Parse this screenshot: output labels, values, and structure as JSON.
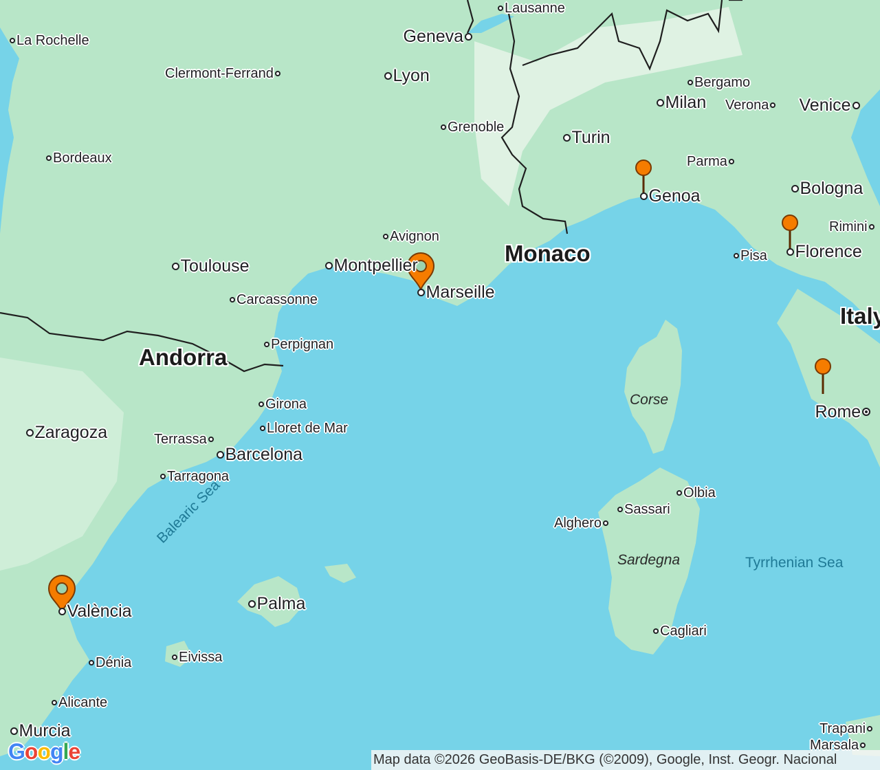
{
  "map": {
    "colors": {
      "water": "#76d3e8",
      "land": "#b8e6c8",
      "land_light": "#cfeed8",
      "marker": "#f57c00",
      "border": "#1f1f1f"
    },
    "cities": [
      {
        "key": "la_rochelle",
        "name": "La Rochelle",
        "size": 1
      },
      {
        "key": "clermont",
        "name": "Clermont-Ferrand",
        "size": 1
      },
      {
        "key": "lyon",
        "name": "Lyon",
        "size": 2
      },
      {
        "key": "geneva",
        "name": "Geneva",
        "size": 2
      },
      {
        "key": "lausanne",
        "name": "Lausanne",
        "size": 1
      },
      {
        "key": "bergamo",
        "name": "Bergamo",
        "size": 1
      },
      {
        "key": "milan",
        "name": "Milan",
        "size": 2
      },
      {
        "key": "verona",
        "name": "Verona",
        "size": 1
      },
      {
        "key": "venice",
        "name": "Venice",
        "size": 2
      },
      {
        "key": "grenoble",
        "name": "Grenoble",
        "size": 1
      },
      {
        "key": "turin",
        "name": "Turin",
        "size": 2
      },
      {
        "key": "bordeaux",
        "name": "Bordeaux",
        "size": 1
      },
      {
        "key": "parma",
        "name": "Parma",
        "size": 1
      },
      {
        "key": "genoa",
        "name": "Genoa",
        "size": 2
      },
      {
        "key": "bologna",
        "name": "Bologna",
        "size": 2
      },
      {
        "key": "avignon",
        "name": "Avignon",
        "size": 1
      },
      {
        "key": "rimini",
        "name": "Rimini",
        "size": 1
      },
      {
        "key": "pisa",
        "name": "Pisa",
        "size": 1
      },
      {
        "key": "florence",
        "name": "Florence",
        "size": 2
      },
      {
        "key": "toulouse",
        "name": "Toulouse",
        "size": 2
      },
      {
        "key": "montpellier",
        "name": "Montpellier",
        "size": 2
      },
      {
        "key": "marseille",
        "name": "Marseille",
        "size": 2
      },
      {
        "key": "carcassonne",
        "name": "Carcassonne",
        "size": 1
      },
      {
        "key": "perpignan",
        "name": "Perpignan",
        "size": 1
      },
      {
        "key": "girona",
        "name": "Girona",
        "size": 1
      },
      {
        "key": "lloret",
        "name": "Lloret de Mar",
        "size": 1
      },
      {
        "key": "zaragoza",
        "name": "Zaragoza",
        "size": 2
      },
      {
        "key": "terrassa",
        "name": "Terrassa",
        "size": 1
      },
      {
        "key": "barcelona",
        "name": "Barcelona",
        "size": 2
      },
      {
        "key": "tarragona",
        "name": "Tarragona",
        "size": 1
      },
      {
        "key": "rome",
        "name": "Rome",
        "size": 2
      },
      {
        "key": "olbia",
        "name": "Olbia",
        "size": 1
      },
      {
        "key": "sassari",
        "name": "Sassari",
        "size": 1
      },
      {
        "key": "alghero",
        "name": "Alghero",
        "size": 1
      },
      {
        "key": "palma",
        "name": "Palma",
        "size": 2
      },
      {
        "key": "valencia",
        "name": "València",
        "size": 2
      },
      {
        "key": "cagliari",
        "name": "Cagliari",
        "size": 1
      },
      {
        "key": "denia",
        "name": "Dénia",
        "size": 1
      },
      {
        "key": "eivissa",
        "name": "Eivissa",
        "size": 1
      },
      {
        "key": "alicante",
        "name": "Alicante",
        "size": 1
      },
      {
        "key": "murcia",
        "name": "Murcia",
        "size": 2
      },
      {
        "key": "trapani",
        "name": "Trapani",
        "size": 1
      },
      {
        "key": "marsala",
        "name": "Marsala",
        "size": 1
      }
    ],
    "countries": {
      "monaco": "Monaco",
      "andorra": "Andorra",
      "italy": "Italy"
    },
    "islands": {
      "corse": "Corse",
      "sardegna": "Sardegna"
    },
    "seas": {
      "balearic": "Balearic Sea",
      "tyrrhenian": "Tyrrhenian Sea"
    },
    "markers": [
      {
        "key": "valencia",
        "type": "pin"
      },
      {
        "key": "marseille",
        "type": "pin"
      },
      {
        "key": "genoa",
        "type": "stick"
      },
      {
        "key": "florence",
        "type": "stick"
      },
      {
        "key": "rome",
        "type": "stick"
      }
    ]
  },
  "attribution": "Map data ©2026 GeoBasis-DE/BKG (©2009), Google, Inst. Geogr. Nacional",
  "logo": {
    "letters": [
      "G",
      "o",
      "o",
      "g",
      "l",
      "e"
    ],
    "colors": [
      "#4285f4",
      "#ea4335",
      "#fbbc05",
      "#4285f4",
      "#34a853",
      "#ea4335"
    ]
  }
}
